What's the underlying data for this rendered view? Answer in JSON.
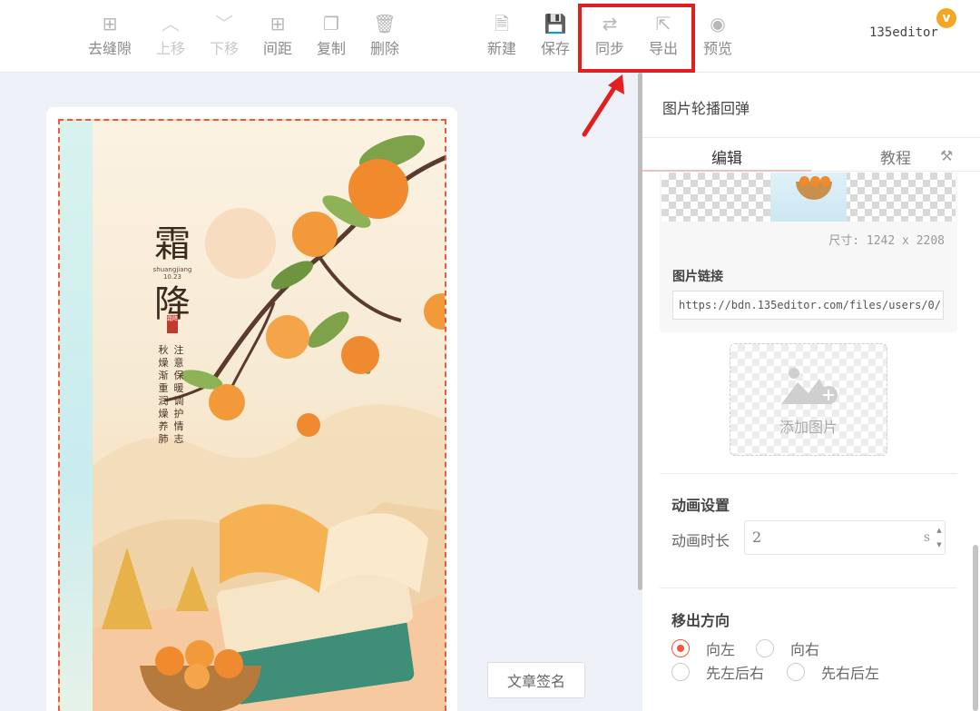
{
  "toolbar": {
    "left_items": [
      {
        "label": "去缝隙",
        "icon": "plus-square-icon"
      },
      {
        "label": "上移",
        "icon": "chevron-up-icon"
      },
      {
        "label": "下移",
        "icon": "chevron-down-icon"
      },
      {
        "label": "间距",
        "icon": "plus-square-icon"
      },
      {
        "label": "复制",
        "icon": "copy-icon"
      },
      {
        "label": "删除",
        "icon": "trash-icon"
      }
    ],
    "right_items": [
      {
        "label": "新建",
        "icon": "file-icon"
      },
      {
        "label": "保存",
        "icon": "save-icon"
      },
      {
        "label": "同步",
        "icon": "sync-arrows-icon"
      },
      {
        "label": "导出",
        "icon": "export-icon"
      },
      {
        "label": "预览",
        "icon": "eye-icon"
      }
    ],
    "brand": "135editor",
    "brand_badge": "v",
    "highlight_color": "#e01f1f"
  },
  "poster": {
    "title_chars": [
      "霜",
      "降"
    ],
    "pinyin": "shuangjiang",
    "date": "10.23",
    "seal": "霜降",
    "poem_col_1": "注意保暖调护情志",
    "poem_col_2": "秋燥渐重润燥养肺"
  },
  "signature_button": "文章签名",
  "panel": {
    "title": "图片轮播回弹",
    "tabs": {
      "edit": "编辑",
      "tutorial": "教程"
    },
    "image_size": "尺寸: 1242 x 2208",
    "image_link_label": "图片链接",
    "image_link_value": "https://bdn.135editor.com/files/users/0/",
    "add_image": "添加图片",
    "animation": {
      "section_title": "动画设置",
      "duration_label": "动画时长",
      "duration_value": "2",
      "duration_unit": "s"
    },
    "direction": {
      "section_title": "移出方向",
      "options": [
        "向左",
        "向右",
        "先左后右",
        "先右后左"
      ],
      "selected": "向左"
    },
    "accent_color": "#f05a3a"
  }
}
